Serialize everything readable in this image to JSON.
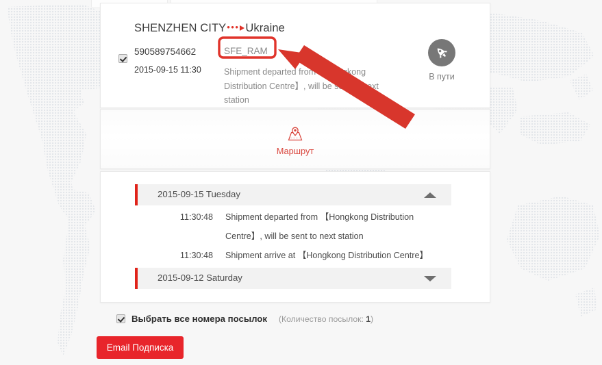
{
  "background": {
    "page_bg": "#f7f7f7",
    "map_dot_color": "#e4e7ea"
  },
  "colors": {
    "accent_red": "#e8252b",
    "annotation_red": "#e0342b",
    "status_gray": "#777777",
    "timeline_bar_red": "#e0231a",
    "group_header_bg": "#f2f2f2"
  },
  "summary_card": {
    "route": {
      "origin": "SHENZHEN CITY",
      "dots": "•••",
      "destination": "Ukraine"
    },
    "checkbox_checked": true,
    "tracking_number": "590589754662",
    "tracking_datetime": "2015-09-15 11:30",
    "carrier_code": "SFE_RAM",
    "latest_event": "Shipment departed from 【Hongkong Distribution Centre】, will be sent to next station",
    "status": {
      "icon": "rocket-icon",
      "label": "В пути"
    }
  },
  "route_card": {
    "icon": "map-pin-icon",
    "label": "Маршрут"
  },
  "history_card": {
    "groups": [
      {
        "date": "2015-09-15 Tuesday",
        "expanded": true,
        "caret": "caret-up-icon",
        "events": [
          {
            "time": "11:30:48",
            "description": "Shipment departed from 【Hongkong Distribution Centre】, will be sent to next station"
          },
          {
            "time": "11:30:48",
            "description": "Shipment arrive at 【Hongkong Distribution Centre】"
          }
        ]
      },
      {
        "date": "2015-09-12 Saturday",
        "expanded": false,
        "caret": "caret-down-icon",
        "events": []
      }
    ]
  },
  "footer": {
    "select_all_checked": true,
    "select_all_label": "Выбрать все номера посылок",
    "count_prefix": "(Количество посылок: ",
    "count_value": "1",
    "count_suffix": ")",
    "email_button_label": "Email Подписка"
  },
  "annotation": {
    "highlight_target": "SFE_RAM",
    "highlight_shape": "rounded-rectangle",
    "arrow": "arrow-pointing-up-left",
    "color": "#e0342b"
  }
}
